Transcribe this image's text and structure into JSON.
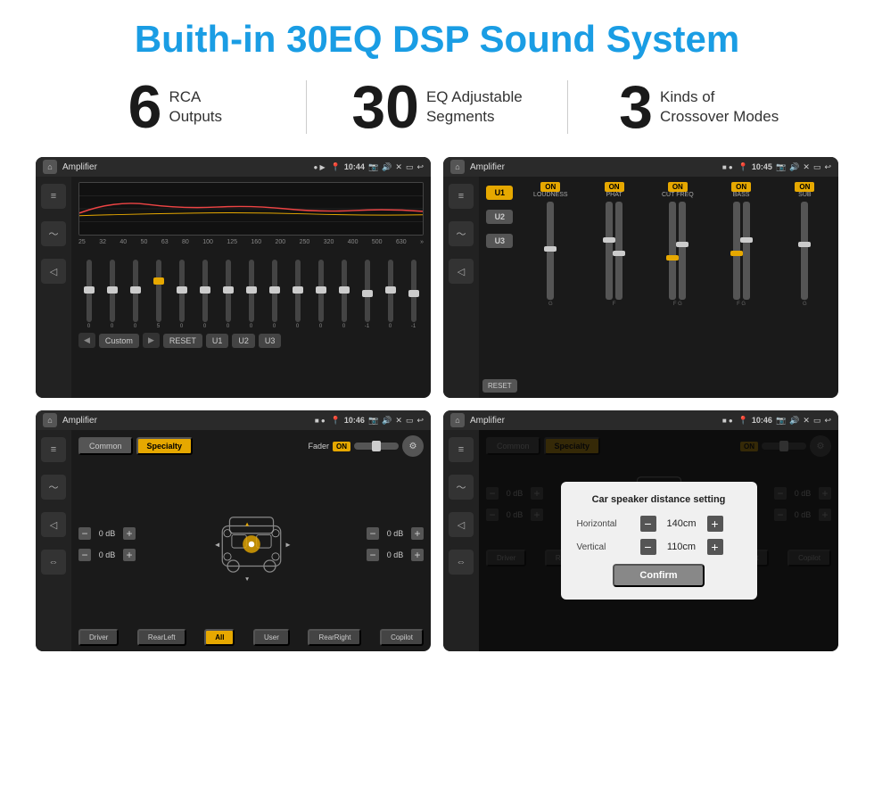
{
  "header": {
    "title": "Buith-in 30EQ DSP Sound System"
  },
  "stats": [
    {
      "number": "6",
      "text_line1": "RCA",
      "text_line2": "Outputs"
    },
    {
      "number": "30",
      "text_line1": "EQ Adjustable",
      "text_line2": "Segments"
    },
    {
      "number": "3",
      "text_line1": "Kinds of",
      "text_line2": "Crossover Modes"
    }
  ],
  "screen1": {
    "status_title": "Amplifier",
    "status_time": "10:44",
    "eq_freqs": [
      "25",
      "32",
      "40",
      "50",
      "63",
      "80",
      "100",
      "125",
      "160",
      "200",
      "250",
      "320",
      "400",
      "500",
      "630"
    ],
    "eq_values": [
      "0",
      "0",
      "0",
      "5",
      "0",
      "0",
      "0",
      "0",
      "0",
      "0",
      "0",
      "0",
      "-1",
      "0",
      "-1"
    ],
    "bottom_buttons": [
      "Custom",
      "RESET",
      "U1",
      "U2",
      "U3"
    ]
  },
  "screen2": {
    "status_title": "Amplifier",
    "status_time": "10:45",
    "u_buttons": [
      "U1",
      "U2",
      "U3"
    ],
    "on_buttons": [
      "ON",
      "ON",
      "ON",
      "ON",
      "ON"
    ],
    "labels": [
      "LOUDNESS",
      "PHAT",
      "CUT FREQ",
      "BASS",
      "SUB"
    ],
    "reset_label": "RESET"
  },
  "screen3": {
    "status_title": "Amplifier",
    "status_time": "10:46",
    "tab_common": "Common",
    "tab_specialty": "Specialty",
    "fader_label": "Fader",
    "fader_on": "ON",
    "vol_labels": [
      "0 dB",
      "0 dB",
      "0 dB",
      "0 dB"
    ],
    "driver_btn": "Driver",
    "copilot_btn": "Copilot",
    "rearleft_btn": "RearLeft",
    "all_btn": "All",
    "user_btn": "User",
    "rearright_btn": "RearRight"
  },
  "screen4": {
    "status_title": "Amplifier",
    "status_time": "10:46",
    "tab_common": "Common",
    "tab_specialty": "Specialty",
    "dialog": {
      "title": "Car speaker distance setting",
      "horizontal_label": "Horizontal",
      "horizontal_value": "140cm",
      "vertical_label": "Vertical",
      "vertical_value": "110cm",
      "confirm_btn": "Confirm"
    },
    "driver_btn": "Driver",
    "copilot_btn": "Copilot",
    "rearleft_btn": "RearLeft",
    "rearright_btn": "RearRight"
  }
}
